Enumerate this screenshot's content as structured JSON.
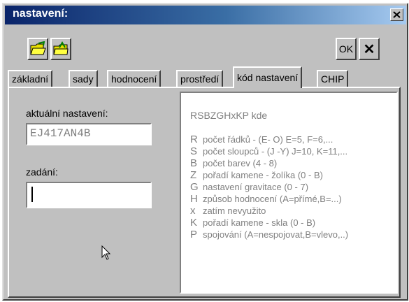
{
  "window": {
    "title": "nastavení:"
  },
  "toolbar": {
    "ok_label": "OK",
    "cancel_label": "✕"
  },
  "tabs": [
    {
      "label": "základní",
      "active": false
    },
    {
      "label": "sady",
      "active": false
    },
    {
      "label": "hodnocení",
      "active": false
    },
    {
      "label": "prostředí",
      "active": false
    },
    {
      "label": "kód nastavení",
      "active": true
    },
    {
      "label": "CHIP",
      "active": false
    }
  ],
  "form": {
    "current_label": "aktuální nastavení:",
    "current_value": "EJ417AN4B",
    "input_label": "zadání:",
    "input_value": ""
  },
  "help": {
    "code": "RSBZGHxKP  kde",
    "items": [
      {
        "key": "R",
        "text": "počet řádků - (E- O) E=5, F=6,..."
      },
      {
        "key": "S",
        "text": "počet sloupců - (J -Y) J=10, K=11,..."
      },
      {
        "key": "B",
        "text": "počet barev (4 - 8)"
      },
      {
        "key": "Z",
        "text": "pořadí kamene - žolíka (0 - B)"
      },
      {
        "key": "G",
        "text": "nastavení gravitace (0 - 7)"
      },
      {
        "key": "H",
        "text": "způsob hodnocení (A=přímé,B=...)"
      },
      {
        "key": "x",
        "text": "zatím nevyužito"
      },
      {
        "key": "K",
        "text": "pořadí kamene - skla (0 - B)"
      },
      {
        "key": "P",
        "text": "spojování (A=nespojovat,B=vlevo,..)"
      }
    ]
  },
  "colors": {
    "titlebar_start": "#0a246a",
    "titlebar_end": "#a6caf0",
    "face": "#c0c0c0"
  }
}
